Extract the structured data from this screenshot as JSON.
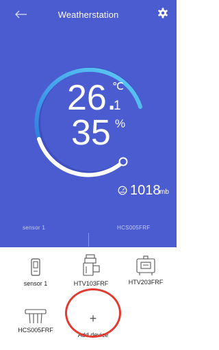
{
  "header": {
    "title": "Weatherstation",
    "back_icon": "arrow-left-icon",
    "settings_icon": "gear-icon"
  },
  "reading": {
    "temperature_int": "26.",
    "temperature_decimal": "1",
    "temperature_unit": "℃",
    "humidity": "35",
    "humidity_unit": "%",
    "pressure": "1018",
    "pressure_unit": "mb",
    "pressure_icon": "gauge-icon"
  },
  "sensor_tabs": [
    {
      "label": "sensor 1"
    },
    {
      "label": "HCS005FRF"
    }
  ],
  "devices": [
    {
      "label": "sensor 1",
      "icon": "sensor-probe-icon"
    },
    {
      "label": "HTV103FRF",
      "icon": "radiator-valve-icon"
    },
    {
      "label": "HTV203FRF",
      "icon": "thermostat-box-icon"
    },
    {
      "label": "HCS005FRF",
      "icon": "soil-sensor-icon"
    },
    {
      "label": "Add device",
      "icon": "plus-icon",
      "symbol": "+"
    }
  ],
  "colors": {
    "background_blue": "#4b5bd0",
    "gauge_track": "#ffffff",
    "gauge_gradient_start": "#5fd0f5",
    "gauge_gradient_end": "#2f7fe0",
    "highlight_circle": "#e33a2f"
  }
}
